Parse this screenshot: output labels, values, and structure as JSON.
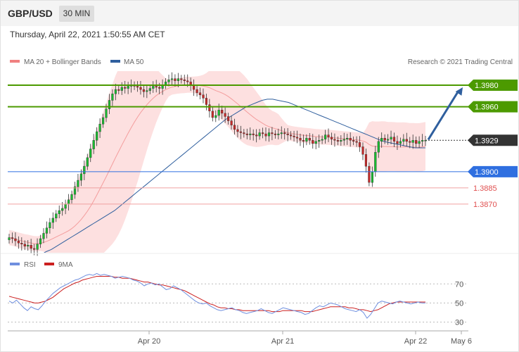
{
  "header": {
    "symbol": "GBP/USD",
    "timeframe": "30 MIN"
  },
  "timestamp": "Thursday, April 22, 2021 1:50:55 AM CET",
  "copyright": "Research © 2021 Trading Central",
  "colors": {
    "candle_up": "#18bb30",
    "candle_down": "#c62828",
    "candle_wick": "#333333",
    "bollinger_fill": "#fde0e0",
    "ma20": "#f08080",
    "ma50": "#2f5f9e",
    "green_level": "#4c9a00",
    "blue_level": "#2f6fe0",
    "red_level": "#e05050",
    "current_price": "#333333",
    "arrow": "#2f5f9e",
    "rsi": "#6f8fdf",
    "rsi_ma": "#cc1f1f"
  },
  "chart_data": [
    {
      "type": "candlestick",
      "legend": [
        {
          "name": "MA 20 + Bollinger Bands",
          "color": "#f08080"
        },
        {
          "name": "MA 50",
          "color": "#2f5f9e"
        }
      ],
      "x_ticks": [
        "Apr 20",
        "Apr 21",
        "Apr 22",
        "May 6"
      ],
      "ylim": [
        1.3825,
        1.3993
      ],
      "closes": [
        1.3839,
        1.3838,
        1.3836,
        1.3834,
        1.3833,
        1.3831,
        1.3832,
        1.3829,
        1.3828,
        1.3833,
        1.3838,
        1.3843,
        1.3848,
        1.3853,
        1.3857,
        1.3861,
        1.3864,
        1.3866,
        1.387,
        1.3874,
        1.3879,
        1.3886,
        1.3892,
        1.3898,
        1.3905,
        1.3913,
        1.3921,
        1.3929,
        1.3937,
        1.3944,
        1.395,
        1.3958,
        1.3966,
        1.3972,
        1.3976,
        1.3975,
        1.3978,
        1.3977,
        1.3979,
        1.398,
        1.3979,
        1.3978,
        1.3976,
        1.3974,
        1.3975,
        1.3977,
        1.3979,
        1.3978,
        1.3977,
        1.398,
        1.3983,
        1.3985,
        1.3986,
        1.3984,
        1.3986,
        1.3985,
        1.3984,
        1.3983,
        1.398,
        1.3976,
        1.3973,
        1.3971,
        1.3968,
        1.3962,
        1.3956,
        1.395,
        1.3952,
        1.3957,
        1.3954,
        1.3951,
        1.3947,
        1.3943,
        1.3939,
        1.3937,
        1.3936,
        1.3935,
        1.3934,
        1.3935,
        1.3934,
        1.3933,
        1.3936,
        1.3935,
        1.3933,
        1.3936,
        1.3935,
        1.3934,
        1.3935,
        1.3936,
        1.3935,
        1.3934,
        1.3933,
        1.3932,
        1.3931,
        1.3929,
        1.3928,
        1.3931,
        1.3929,
        1.3926,
        1.3928,
        1.3929,
        1.393,
        1.3934,
        1.3932,
        1.393,
        1.3929,
        1.3928,
        1.3929,
        1.393,
        1.3931,
        1.3929,
        1.3928,
        1.3927,
        1.3923,
        1.3916,
        1.3905,
        1.389,
        1.39,
        1.3918,
        1.3928,
        1.3931,
        1.3929,
        1.393,
        1.3932,
        1.3928,
        1.3926,
        1.3928,
        1.393,
        1.3928,
        1.3927,
        1.3929,
        1.3926,
        1.3928,
        1.3929,
        1.3929
      ],
      "ma50": [
        1.3808,
        1.3811,
        1.3813,
        1.3816,
        1.3818,
        1.3821,
        1.3823,
        1.3826,
        1.3828,
        1.3831,
        1.3834,
        1.3837,
        1.384,
        1.3843,
        1.3846,
        1.3849,
        1.3852,
        1.3855,
        1.3858,
        1.3861,
        1.3864,
        1.3868,
        1.3872,
        1.3876,
        1.388,
        1.3884,
        1.3888,
        1.3892,
        1.3896,
        1.39,
        1.3904,
        1.3908,
        1.3912,
        1.3916,
        1.392,
        1.3924,
        1.3928,
        1.3932,
        1.3936,
        1.394,
        1.3944,
        1.3948,
        1.3951,
        1.3954,
        1.3957,
        1.396,
        1.3962,
        1.3964,
        1.3966,
        1.3967,
        1.3967,
        1.3966,
        1.3965,
        1.3964,
        1.3962,
        1.396,
        1.3958,
        1.3956,
        1.3954,
        1.3952,
        1.395,
        1.3948,
        1.3946,
        1.3944,
        1.3942,
        1.394,
        1.3938,
        1.3936,
        1.3934,
        1.3932,
        1.393,
        1.3928,
        1.3927,
        1.3926,
        1.3925,
        1.3924,
        1.3923,
        1.3922,
        1.3922,
        1.3922
      ],
      "levels": [
        {
          "label": "1.3980",
          "value": 1.398,
          "role": "resistance"
        },
        {
          "label": "1.3960",
          "value": 1.396,
          "role": "resistance"
        },
        {
          "label": "1.3929",
          "value": 1.3929,
          "role": "last-price"
        },
        {
          "label": "1.3900",
          "value": 1.39,
          "role": "pivot"
        },
        {
          "label": "1.3885",
          "value": 1.3885,
          "role": "support"
        },
        {
          "label": "1.3870",
          "value": 1.387,
          "role": "support"
        }
      ],
      "annotations": [
        "upward arrow projection toward 1.3980"
      ]
    },
    {
      "type": "line",
      "legend": [
        {
          "name": "RSI",
          "color": "#6f8fdf"
        },
        {
          "name": "9MA",
          "color": "#cc1f1f"
        }
      ],
      "ylim": [
        20,
        85
      ],
      "y_ticks": [
        "70",
        "50",
        "30"
      ],
      "rsi": [
        52,
        50,
        53,
        49,
        45,
        42,
        46,
        44,
        43,
        47,
        52,
        56,
        60,
        63,
        66,
        68,
        70,
        72,
        74,
        75,
        77,
        79,
        80,
        79,
        81,
        79,
        80,
        79,
        78,
        76,
        77,
        78,
        77,
        76,
        74,
        73,
        71,
        68,
        70,
        71,
        69,
        70,
        67,
        64,
        65,
        68,
        66,
        64,
        61,
        58,
        55,
        52,
        50,
        49,
        50,
        47,
        45,
        43,
        42,
        43,
        44,
        45,
        43,
        42,
        40,
        39,
        40,
        41,
        42,
        44,
        42,
        40,
        39,
        41,
        43,
        45,
        44,
        43,
        42,
        41,
        40,
        38,
        39,
        42,
        45,
        47,
        46,
        48,
        50,
        49,
        48,
        46,
        44,
        43,
        42,
        41,
        43,
        40,
        34,
        38,
        44,
        50,
        52,
        51,
        50,
        49,
        51,
        52,
        51,
        50,
        49,
        50,
        51,
        50,
        50
      ],
      "ma9": [
        57,
        56,
        55,
        54,
        53,
        52,
        51,
        50,
        50,
        51,
        52,
        54,
        56,
        59,
        62,
        65,
        67,
        69,
        71,
        72,
        74,
        75,
        76,
        77,
        78,
        78,
        78,
        78,
        78,
        77,
        77,
        76,
        76,
        76,
        75,
        74,
        73,
        72,
        72,
        71,
        70,
        69,
        69,
        68,
        67,
        66,
        65,
        64,
        63,
        61,
        59,
        57,
        55,
        53,
        51,
        49,
        48,
        46,
        45,
        45,
        44,
        44,
        43,
        43,
        42,
        42,
        42,
        42,
        42,
        42,
        42,
        42,
        41,
        41,
        41,
        42,
        42,
        42,
        42,
        42,
        42,
        41,
        41,
        41,
        42,
        43,
        44,
        45,
        46,
        46,
        46,
        46,
        46,
        45,
        45,
        44,
        43,
        43,
        42,
        41,
        42,
        43,
        45,
        47,
        49,
        50,
        51,
        51,
        51,
        51,
        51,
        51,
        51,
        51,
        51
      ]
    }
  ]
}
